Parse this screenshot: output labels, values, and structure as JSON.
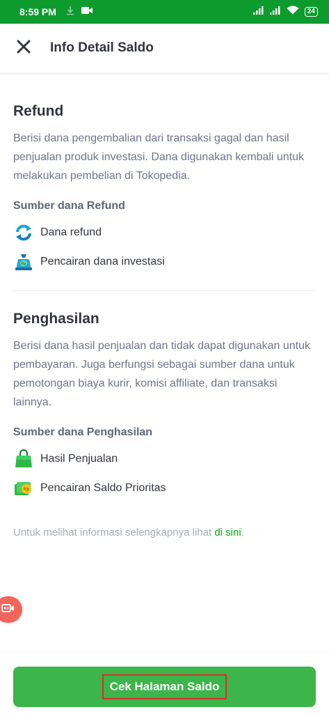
{
  "status_bar": {
    "time": "8:59 PM",
    "battery": "24",
    "icons": [
      "download-icon",
      "video-icon",
      "signal-icon",
      "signal-icon",
      "wifi-icon",
      "battery-icon"
    ]
  },
  "header": {
    "title": "Info Detail Saldo",
    "close_icon": "close-icon"
  },
  "refund": {
    "title": "Refund",
    "description": "Berisi dana pengembalian dari transaksi gagal dan hasil penjualan produk investasi. Dana digunakan kembali untuk melakukan pembelian di Tokopedia.",
    "sources_title": "Sumber dana Refund",
    "sources": [
      {
        "label": "Dana refund",
        "icon": "refund-arrows-icon"
      },
      {
        "label": "Pencairan dana investasi",
        "icon": "investment-bag-icon"
      }
    ]
  },
  "penghasilan": {
    "title": "Penghasilan",
    "description": "Berisi dana hasil penjualan dan tidak dapat digunakan untuk pembayaran. Juga berfungsi sebagai sumber dana untuk pemotongan biaya kurir, komisi affiliate, dan transaksi lainnya.",
    "sources_title": "Sumber dana Penghasilan",
    "sources": [
      {
        "label": "Hasil Penjualan",
        "icon": "shopping-bag-icon"
      },
      {
        "label": "Pencairan Saldo Prioritas",
        "icon": "money-coin-icon"
      }
    ]
  },
  "more_info": {
    "text": "Untuk melihat informasi selengkapnya lihat ",
    "link": "di sini",
    "suffix": "."
  },
  "cta": {
    "label": "Cek Halaman Saldo"
  },
  "colors": {
    "status_bar": "#0d9b2e",
    "primary_button": "#3cb54a",
    "link": "#03ac0e",
    "highlight_border": "#d8302a"
  }
}
